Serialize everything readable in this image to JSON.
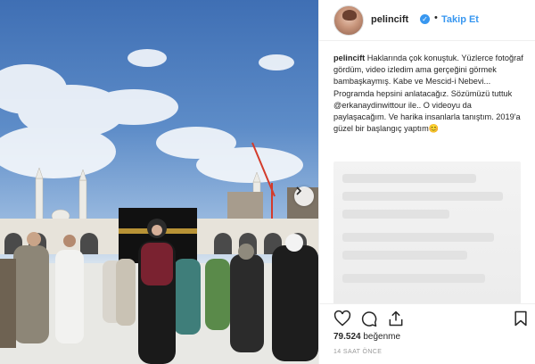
{
  "post": {
    "username": "pelincift",
    "follow_label": "Takip Et",
    "separator": "•",
    "caption_user": "pelincift",
    "caption_text": "Haklarında çok konuştuk. Yüzlerce fotoğraf gördüm, video izledim ama gerçeğini görmek bambaşkaymış. Kabe ve Mescid-i Nebevi... Programda hepsini anlatacağız. Sözümüzü tuttuk @erkanaydinwittour ile.. O videoyu da paylaşacağım. Ve harika insanlarla tanıştım. 2019'a güzel bir başlangıç yaptım😊",
    "likes_count": "79.524",
    "likes_label": "beğenme",
    "time_ago": "14 SAAT ÖNCE"
  },
  "icons": {
    "verified": "verified-badge-icon",
    "like": "heart-icon",
    "comment": "comment-icon",
    "share": "share-icon",
    "save": "bookmark-icon",
    "next": "chevron-right-icon"
  },
  "colors": {
    "accent": "#3897f0",
    "text": "#262626",
    "muted": "#999999"
  }
}
